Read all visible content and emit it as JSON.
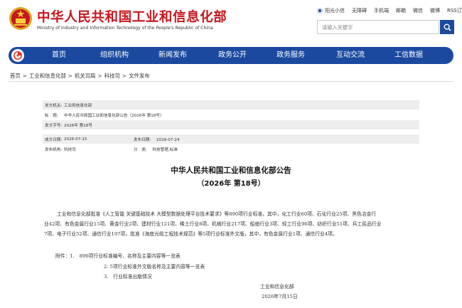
{
  "header": {
    "title_cn": "中华人民共和国工业和信息化部",
    "title_en": "Ministry of Industry and Information Technology of the People's Republic of China",
    "toplinks": [
      "阳光小信",
      "无障碍",
      "手机端",
      "邮箱",
      "微信",
      "微博",
      "RSS订阅"
    ],
    "search_placeholder": "请输入关键字"
  },
  "nav": {
    "items": [
      "首页",
      "组织机构",
      "新闻发布",
      "政务公开",
      "政务服务",
      "互动交流",
      "工信数据"
    ]
  },
  "breadcrumb": [
    "首页",
    "工业和信息化部",
    "机关司局",
    "科技司",
    "文件发布"
  ],
  "meta": {
    "issuer_label": "发文机关:",
    "issuer": "工业和信息化部",
    "title_label": "标　题:",
    "title": "中华人民共和国工业和信息化部公告（2026年 第18号）",
    "docno_label": "发文字号:",
    "docno": "2026年 第18号",
    "written_label": "成文日期:",
    "written": "2026-07-15",
    "published_label": "发布日期:",
    "published": "2026-07-24",
    "agency_label": "发布机构:",
    "agency": "科技司",
    "category_label": "分　类:",
    "category": "科技管理,标准"
  },
  "document": {
    "title_line1": "中华人民共和国工业和信息化部公告",
    "title_line2": "（2026年 第18号）",
    "paragraph_lines": [
      "工业和信息化部批准《人工智能 关键基础技术 大模型数据处理平台技术要求》等890项行业标准，其中，化工行业60项、石化行业25项、黑色冶金行",
      "业42项、有色金属行业15项、黄金行业2项、建材行业121项、稀土行业8项、机械行业217项、船舶行业3项、轻工行业90项、纺织行业51项、兵工民品行业",
      "7项、电子行业52项、通信行业197项，批准《海底光缆工程技术规范》等5项行业标准外文版，其中，有色金属行业1项、通信行业4项。"
    ],
    "attachments": [
      "附件：1.　890项行业标准编号、名称及主要内容等一览表",
      "2. 5项行业标准外文版名称及主要内容等一览表",
      "3.　行业标准出版情况"
    ],
    "signature": "工业和信息化部",
    "sign_date": "2026年7月15日"
  },
  "colors": {
    "brand_red": "#c8161d",
    "nav_blue": "#1b49a0",
    "search_blue": "#1d4a9c"
  }
}
